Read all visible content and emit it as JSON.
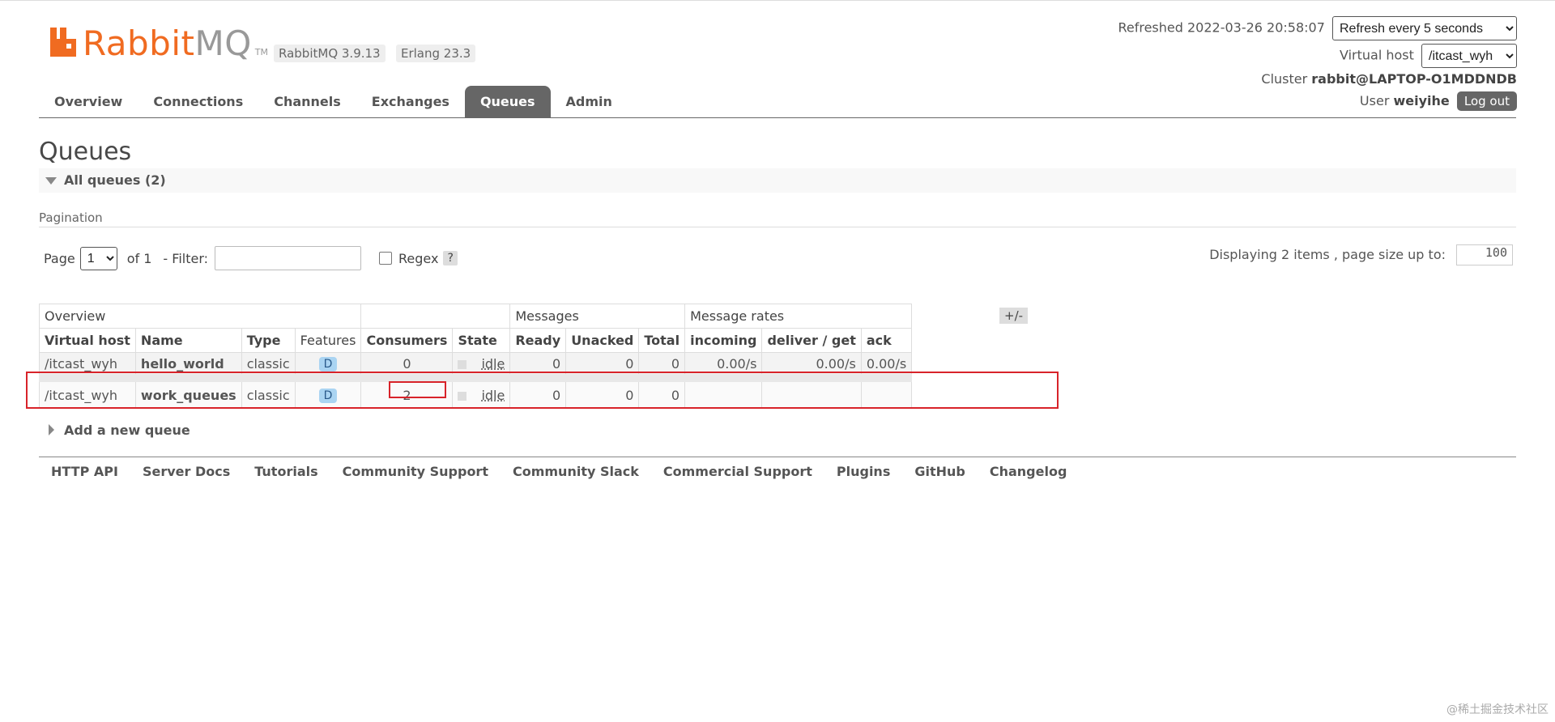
{
  "app": {
    "brand_main": "Rabbit",
    "brand_mq": "MQ",
    "tm": "TM",
    "version": "RabbitMQ 3.9.13",
    "erlang": "Erlang 23.3"
  },
  "header": {
    "refreshed_label": "Refreshed 2022-03-26 20:58:07",
    "refresh_option": "Refresh every 5 seconds",
    "vhost_label": "Virtual host",
    "vhost_value": "/itcast_wyh",
    "cluster_label": "Cluster",
    "cluster_value": "rabbit@LAPTOP-O1MDDNDB",
    "user_label": "User",
    "user_value": "weiyihe",
    "logout": "Log out"
  },
  "nav": {
    "tabs": [
      {
        "label": "Overview"
      },
      {
        "label": "Connections"
      },
      {
        "label": "Channels"
      },
      {
        "label": "Exchanges"
      },
      {
        "label": "Queues",
        "active": true
      },
      {
        "label": "Admin"
      }
    ]
  },
  "page": {
    "title": "Queues",
    "section": "All queues (2)",
    "pagination_heading": "Pagination",
    "page_label": "Page",
    "page_value": "1",
    "of_label": "of 1",
    "filter_label": "- Filter:",
    "filter_value": "",
    "regex_label": "Regex",
    "help": "?",
    "displaying": "Displaying 2 items , page size up to:",
    "page_size": "100"
  },
  "table": {
    "groups": [
      "Overview",
      "Messages",
      "Message rates"
    ],
    "toggle": "+/-",
    "columns": [
      "Virtual host",
      "Name",
      "Type",
      "Features",
      "Consumers",
      "State",
      "Ready",
      "Unacked",
      "Total",
      "incoming",
      "deliver / get",
      "ack"
    ],
    "rows": [
      {
        "vhost": "/itcast_wyh",
        "name": "hello_world",
        "type": "classic",
        "feature": "D",
        "consumers": "0",
        "state": "idle",
        "ready": "0",
        "unacked": "0",
        "total": "0",
        "incoming": "0.00/s",
        "deliver": "0.00/s",
        "ack": "0.00/s"
      },
      {
        "vhost": "/itcast_wyh",
        "name": "work_queues",
        "type": "classic",
        "feature": "D",
        "consumers": "2",
        "state": "idle",
        "ready": "0",
        "unacked": "0",
        "total": "0",
        "incoming": "",
        "deliver": "",
        "ack": ""
      }
    ]
  },
  "add_queue": "Add a new queue",
  "footer": {
    "links": [
      "HTTP API",
      "Server Docs",
      "Tutorials",
      "Community Support",
      "Community Slack",
      "Commercial Support",
      "Plugins",
      "GitHub",
      "Changelog"
    ]
  },
  "watermark": "@稀土掘金技术社区",
  "colors": {
    "brand": "#f06b21",
    "active_tab": "#666666",
    "highlight": "#d8232a",
    "badge": "#aad4f2"
  }
}
